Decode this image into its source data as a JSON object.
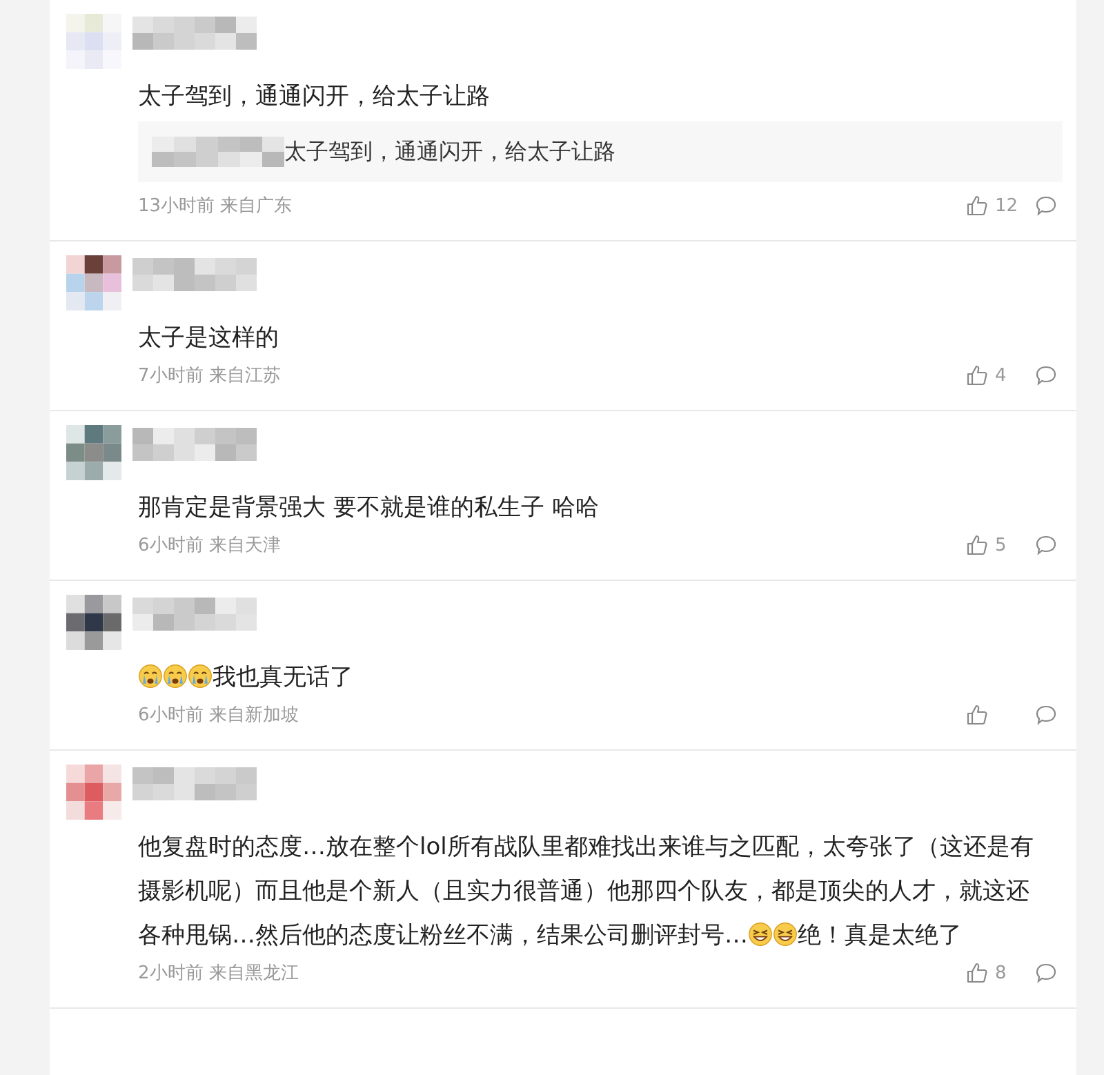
{
  "comments": [
    {
      "text": [
        {
          "kind": "text",
          "text": "太子驾到，通通闪开，给太子让路"
        }
      ],
      "quote": {
        "text": "太子驾到，通通闪开，给太子让路"
      },
      "meta": "13小时前 来自广东",
      "likes": "12"
    },
    {
      "text": [
        {
          "kind": "text",
          "text": "太子是这样的"
        }
      ],
      "meta": "7小时前 来自江苏",
      "likes": "4"
    },
    {
      "text": [
        {
          "kind": "text",
          "text": "那肯定是背景强大 要不就是谁的私生子 哈哈"
        }
      ],
      "meta": "6小时前 来自天津",
      "likes": "5"
    },
    {
      "text": [
        {
          "kind": "cry"
        },
        {
          "kind": "cry"
        },
        {
          "kind": "cry"
        },
        {
          "kind": "text",
          "text": "我也真无话了"
        }
      ],
      "meta": "6小时前 来自新加坡"
    },
    {
      "text": [
        {
          "kind": "text",
          "text": "他复盘时的态度…放在整个lol所有战队里都难找出来谁与之匹配，太夸张了（这还是有摄影机呢）而且他是个新人（且实力很普通）他那四个队友，都是顶尖的人才，就这还各种甩锅…然后他的态度让粉丝不满，结果公司删评封号…"
        },
        {
          "kind": "grin"
        },
        {
          "kind": "grin"
        },
        {
          "kind": "text",
          "text": "绝！真是太绝了"
        }
      ],
      "meta": "2小时前 来自黑龙江",
      "likes": "8"
    }
  ]
}
